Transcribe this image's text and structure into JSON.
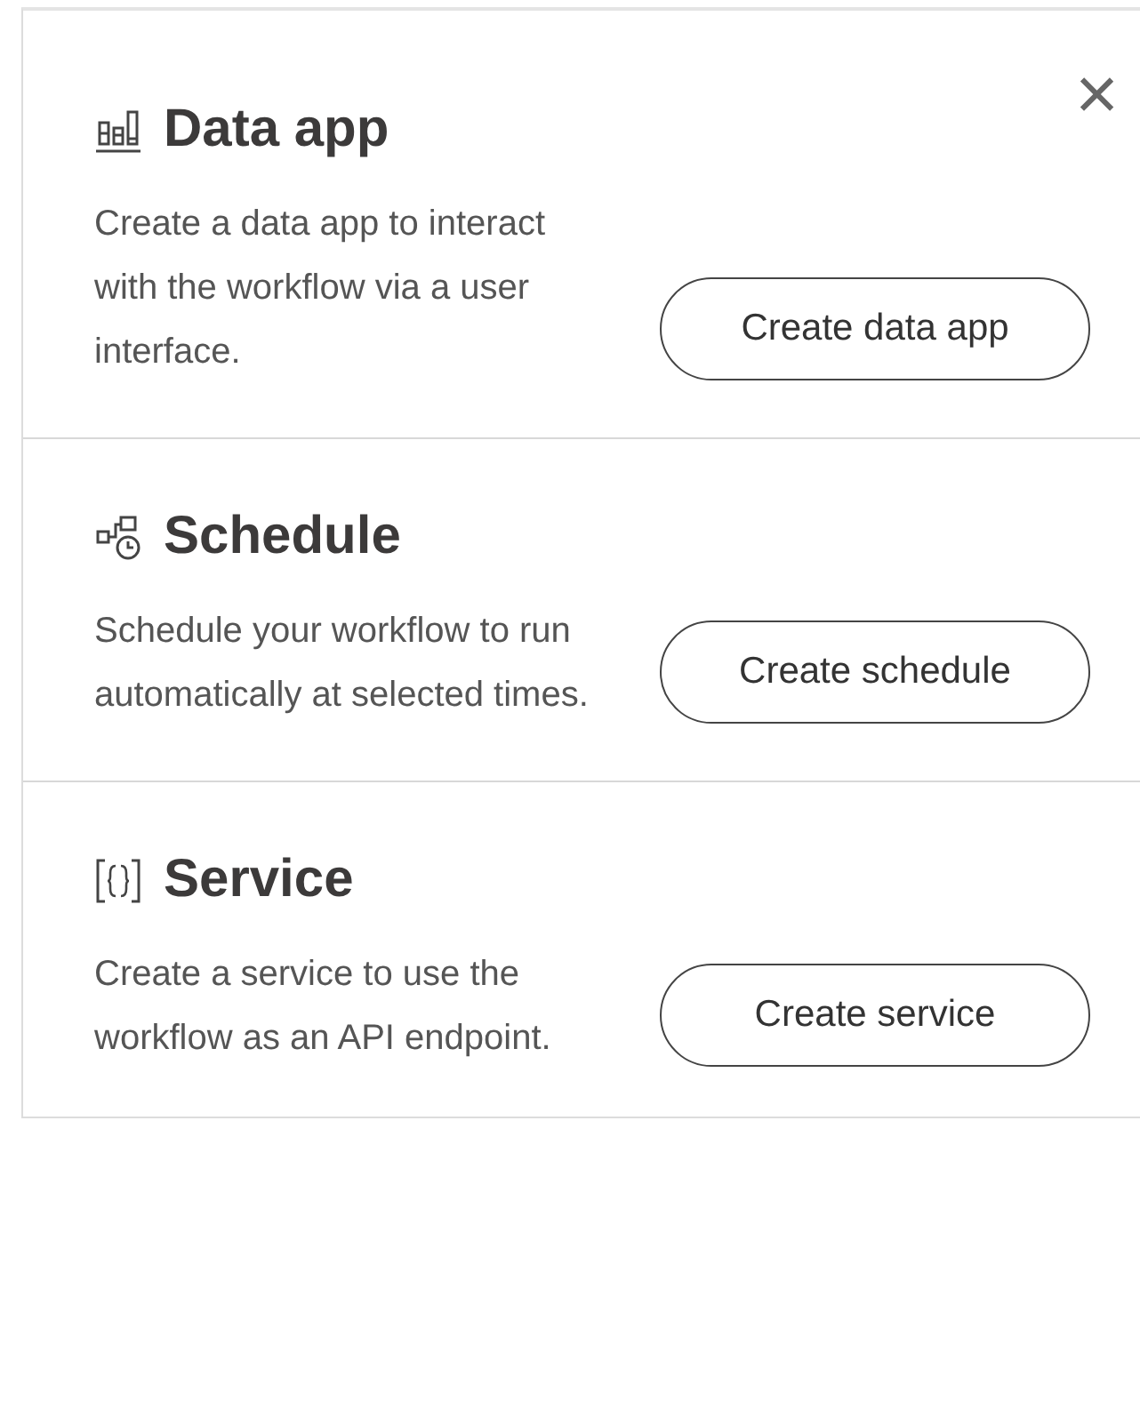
{
  "close_button": {
    "label": "×"
  },
  "sections": [
    {
      "kind": "data-app",
      "title": "Data app",
      "description": "Create a data app to interact with the workflow via a user interface.",
      "button": "Create data app"
    },
    {
      "kind": "schedule",
      "title": "Schedule",
      "description": "Schedule your workflow to run automatically at selected times.",
      "button": "Create schedule"
    },
    {
      "kind": "service",
      "title": "Service",
      "description": "Create a service to use the workflow as an API endpoint.",
      "button": "Create service"
    }
  ]
}
